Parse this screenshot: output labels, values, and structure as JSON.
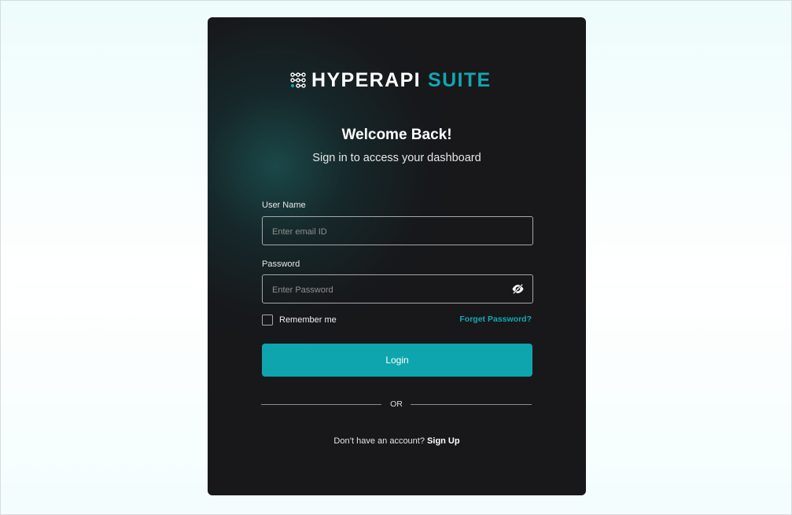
{
  "brand": {
    "primary": "HYPERAPI",
    "accent": "SUITE",
    "accent_color": "#12a7b0"
  },
  "header": {
    "title": "Welcome Back!",
    "subtitle": "Sign in to access your dashboard"
  },
  "form": {
    "username": {
      "label": "User Name",
      "placeholder": "Enter email ID",
      "value": ""
    },
    "password": {
      "label": "Password",
      "placeholder": "Enter Password",
      "value": "",
      "toggle_icon": "eye-off-icon"
    },
    "remember": {
      "label": "Remember me",
      "checked": false
    },
    "forgot_label": "Forget Password?",
    "login_label": "Login"
  },
  "divider": {
    "label": "OR"
  },
  "footer": {
    "question": "Don’t have an account?",
    "signup_label": "Sign Up"
  },
  "colors": {
    "card_background": "#18171a",
    "button": "#0fa5ae",
    "page_background": "#f3fdfd"
  }
}
